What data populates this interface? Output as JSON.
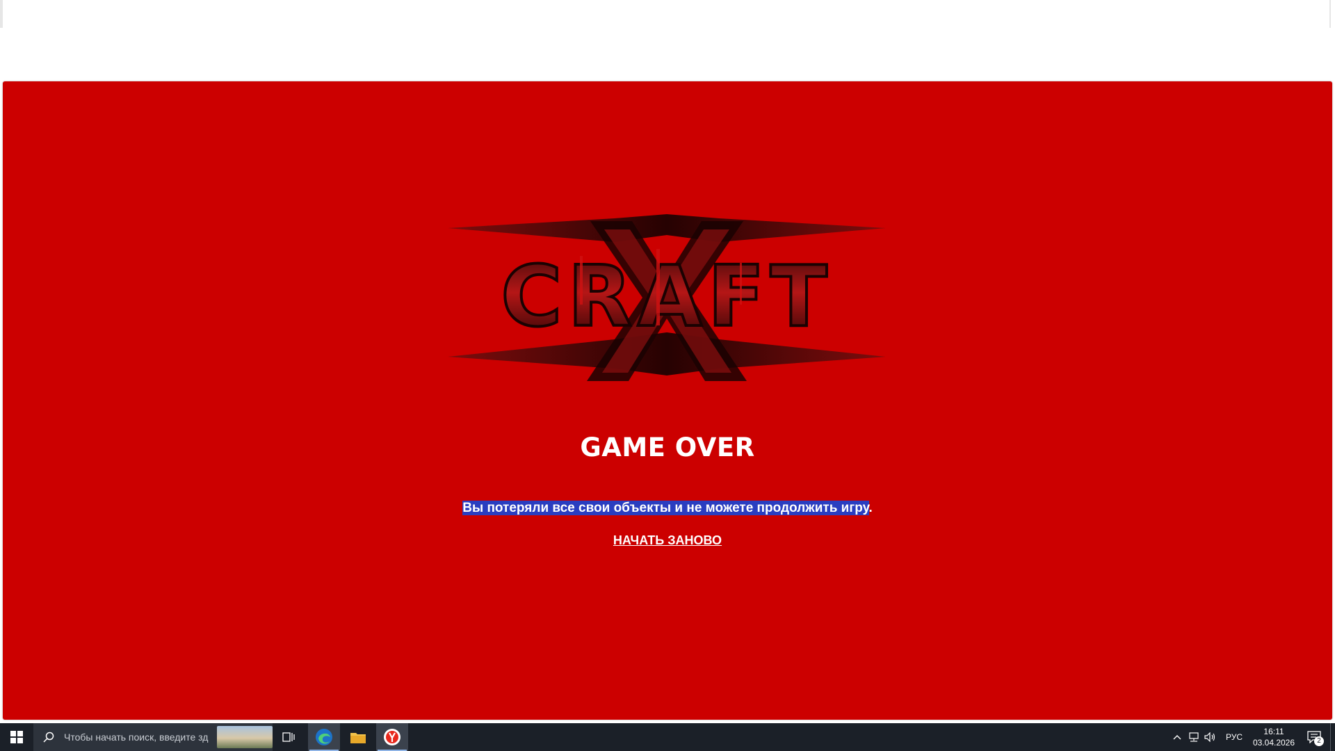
{
  "game": {
    "logo_text": "CRAFT",
    "headline": "GAME OVER",
    "message_selected": "Вы потеряли все свои объекты и не можете продолжить игру",
    "message_tail": ".",
    "restart_label": "НАЧАТЬ ЗАНОВО",
    "background_color": "#cc0000"
  },
  "taskbar": {
    "search_placeholder": "Чтобы начать поиск, введите зд",
    "pinned": [
      "edge-icon",
      "file-explorer-icon",
      "yandex-browser-icon"
    ],
    "language": "РУС",
    "time": "16:11",
    "date": "03.04.2026",
    "notification_count": "2"
  }
}
